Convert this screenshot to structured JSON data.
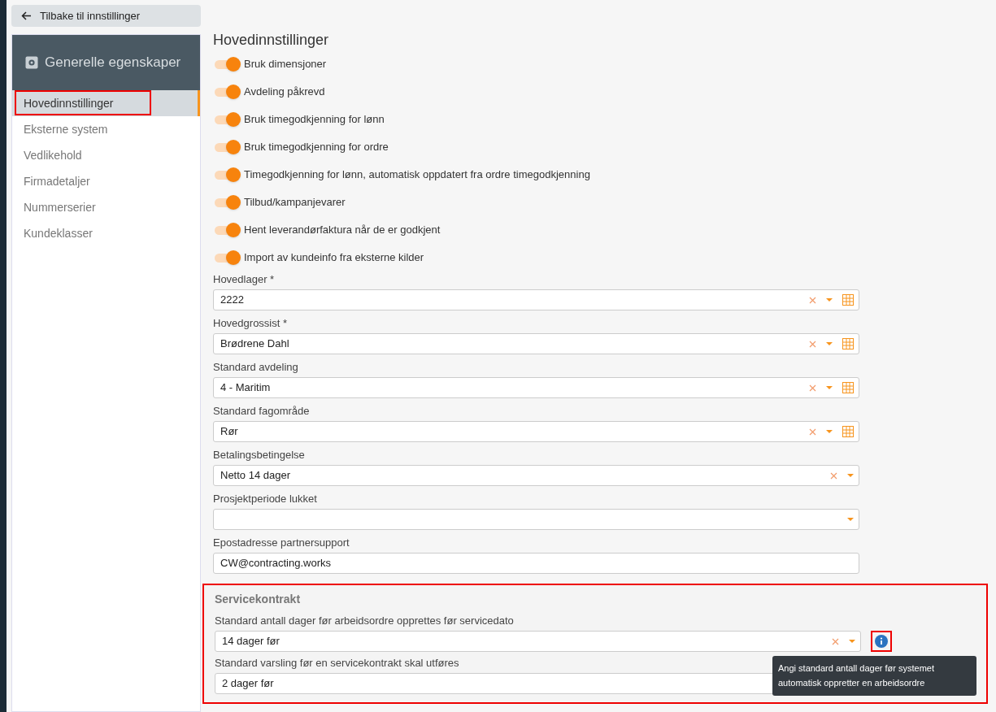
{
  "back_button": {
    "label": "Tilbake til innstillinger"
  },
  "sidebar": {
    "title": "Generelle egenskaper",
    "items": [
      {
        "label": "Hovedinnstillinger",
        "selected": true,
        "highlighted": true
      },
      {
        "label": "Eksterne system",
        "selected": false,
        "highlighted": false
      },
      {
        "label": "Vedlikehold",
        "selected": false,
        "highlighted": false
      },
      {
        "label": "Firmadetaljer",
        "selected": false,
        "highlighted": false
      },
      {
        "label": "Nummerserier",
        "selected": false,
        "highlighted": false
      },
      {
        "label": "Kundeklasser",
        "selected": false,
        "highlighted": false
      }
    ]
  },
  "page_title": "Hovedinnstillinger",
  "toggles": [
    {
      "label": "Bruk dimensjoner",
      "on": true
    },
    {
      "label": "Avdeling påkrevd",
      "on": true
    },
    {
      "label": "Bruk timegodkjenning for lønn",
      "on": true
    },
    {
      "label": "Bruk timegodkjenning for ordre",
      "on": true
    },
    {
      "label": "Timegodkjenning for lønn, automatisk oppdatert fra ordre timegodkjenning",
      "on": true
    },
    {
      "label": "Tilbud/kampanjevarer",
      "on": true
    },
    {
      "label": "Hent leverandørfaktura når de er godkjent",
      "on": true
    },
    {
      "label": "Import av kundeinfo fra eksterne kilder",
      "on": true
    }
  ],
  "fields": [
    {
      "label": "Hovedlager *",
      "value": "2222",
      "kind": "lookup"
    },
    {
      "label": "Hovedgrossist *",
      "value": "Brødrene Dahl",
      "kind": "lookup"
    },
    {
      "label": "Standard avdeling",
      "value": "4 - Maritim",
      "kind": "lookup"
    },
    {
      "label": "Standard fagområde",
      "value": "Rør",
      "kind": "lookup"
    },
    {
      "label": "Betalingsbetingelse",
      "value": "Netto 14 dager",
      "kind": "select"
    },
    {
      "label": "Prosjektperiode lukket",
      "kind": "dropdown"
    },
    {
      "label": "Epostadresse partnersupport",
      "value": "CW@contracting.works",
      "kind": "text"
    }
  ],
  "service_section": {
    "title": "Servicekontrakt",
    "highlighted": true,
    "fields": [
      {
        "label": "Standard antall dager før arbeidsordre opprettes før servicedato",
        "value": "14 dager før",
        "kind": "select",
        "info_highlighted": true
      },
      {
        "label": "Standard varsling før en servicekontrakt skal utføres",
        "value": "2 dager før",
        "kind": "covered"
      }
    ],
    "tooltip": "Angi standard antall dager før systemet automatisk oppretter en arbeidsordre"
  }
}
